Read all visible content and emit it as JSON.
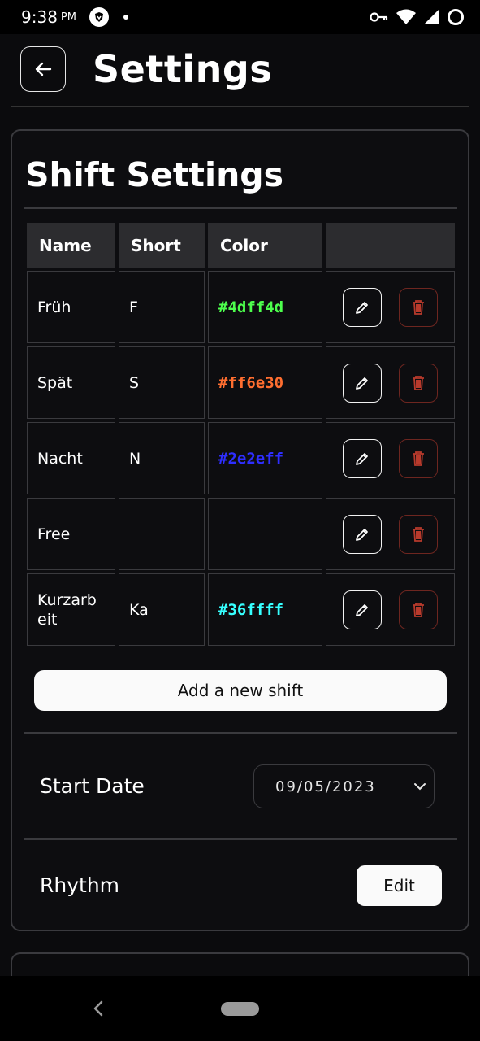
{
  "status_bar": {
    "time": "9:38",
    "ampm": "PM"
  },
  "header": {
    "title": "Settings"
  },
  "shift_settings": {
    "title": "Shift Settings",
    "columns": [
      "Name",
      "Short",
      "Color",
      ""
    ],
    "rows": [
      {
        "name": "Früh",
        "short": "F",
        "color": "#4dff4d"
      },
      {
        "name": "Spät",
        "short": "S",
        "color": "#ff6e30"
      },
      {
        "name": "Nacht",
        "short": "N",
        "color": "#2e2eff"
      },
      {
        "name": "Free",
        "short": "",
        "color": ""
      },
      {
        "name": "Kurzarb eit",
        "short": "Ka",
        "color": "#36ffff"
      }
    ],
    "add_button_label": "Add a new shift",
    "start_date": {
      "label": "Start Date",
      "value": "09/05/2023"
    },
    "rhythm": {
      "label": "Rhythm",
      "edit_label": "Edit"
    }
  },
  "icons": {
    "back": "arrow-left-icon",
    "edit": "pencil-icon",
    "delete": "trash-icon",
    "dropdown": "chevron-down-icon"
  },
  "colors": {
    "background": "#0b0b0d",
    "border": "#3a3a3e",
    "table_header": "#2c2c2f",
    "delete_accent": "#b83a2c"
  }
}
